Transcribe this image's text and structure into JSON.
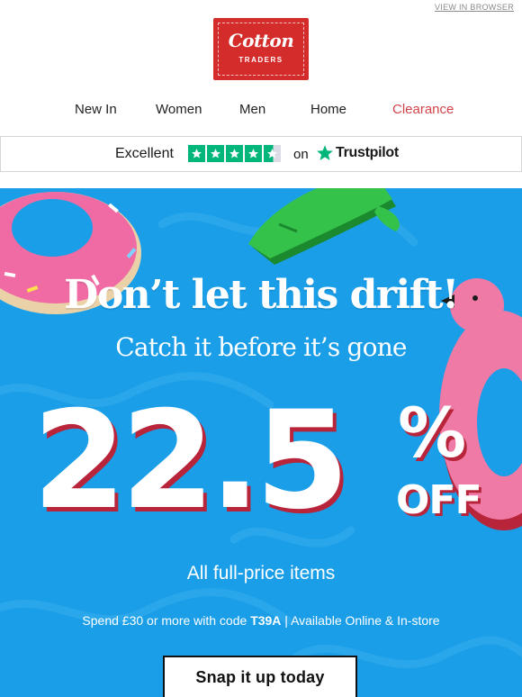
{
  "header": {
    "view_in_browser": "VIEW IN BROWSER",
    "logo": {
      "line1": "Cotton",
      "line2": "TRADERS",
      "color": "#d42b2b"
    }
  },
  "nav": {
    "items": [
      {
        "label": "New In"
      },
      {
        "label": "Women"
      },
      {
        "label": "Men"
      },
      {
        "label": "Home"
      },
      {
        "label": "Clearance",
        "color": "#d2444b"
      }
    ]
  },
  "trustpilot": {
    "rating_text": "Excellent",
    "stars": 4.5,
    "on_text": "on",
    "brand": "Trustpilot",
    "star_color": "#00b67a"
  },
  "hero": {
    "background_color": "#1a9ee8",
    "headline": "Don’t let this drift!",
    "subheadline": "Catch it before it’s gone",
    "discount_value": "22.5",
    "discount_symbol": "%",
    "discount_off": "OFF",
    "items_text": "All full-price items",
    "spend_prefix": "Spend £30 or more with code ",
    "code": "T39A",
    "spend_suffix": " | Available Online & In-store",
    "cta_label": "Snap it up today",
    "decorations": [
      "donut-float",
      "crocodile-float",
      "flamingo-float"
    ]
  }
}
